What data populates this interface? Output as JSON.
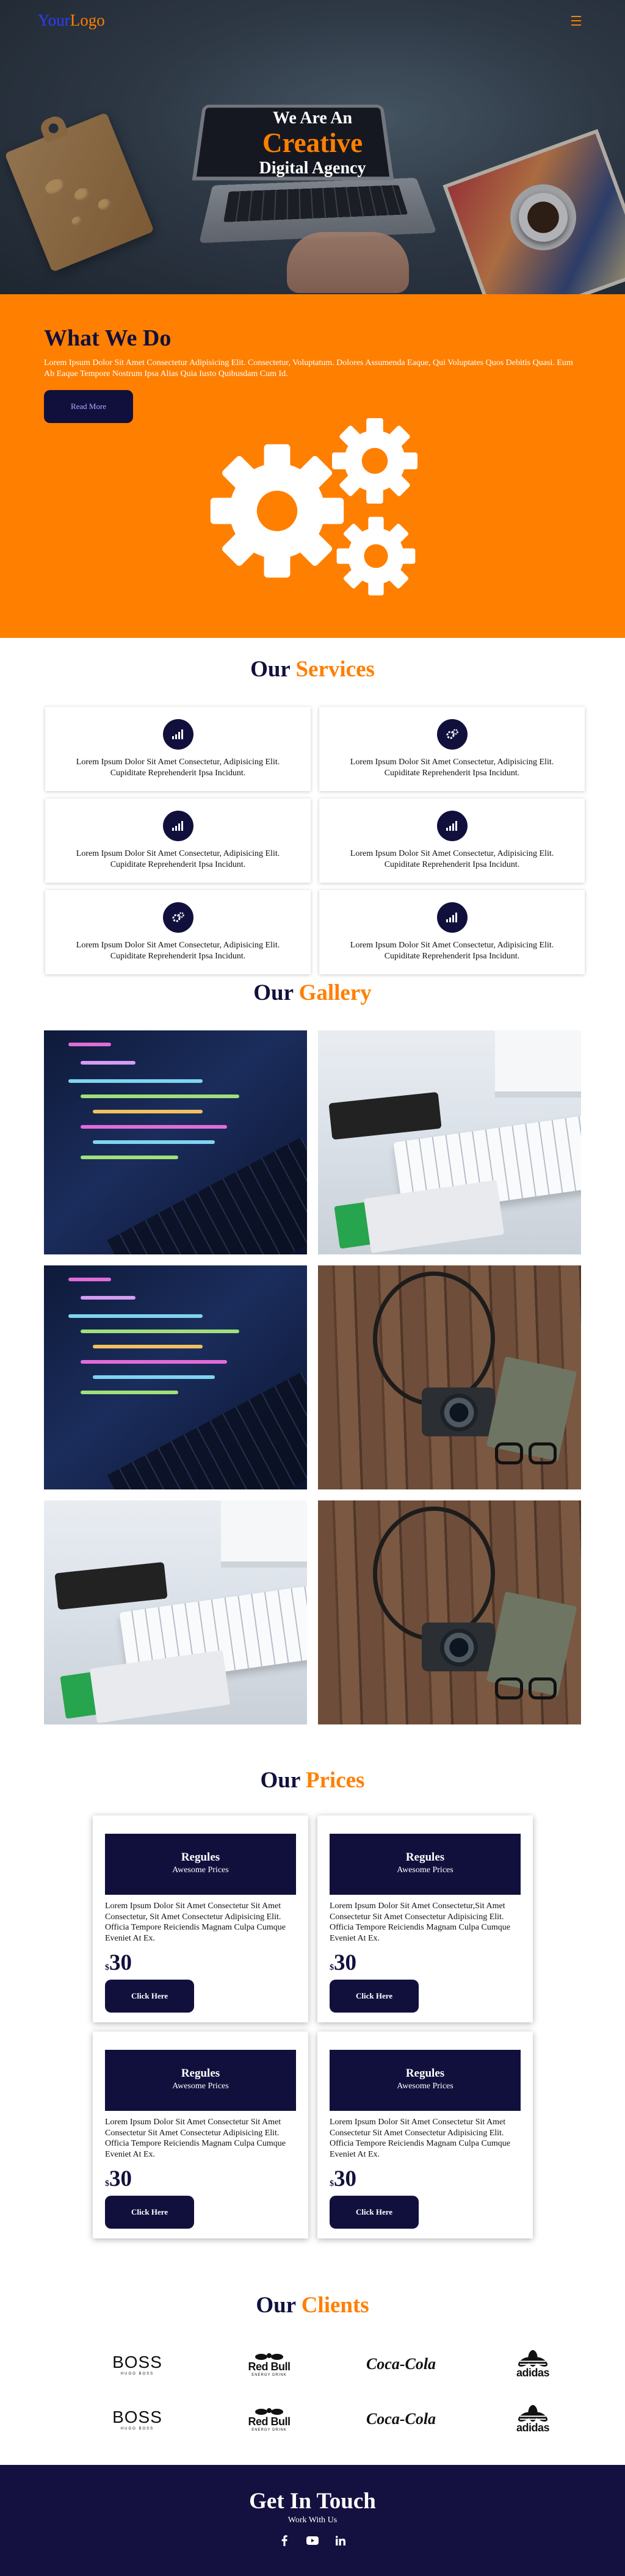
{
  "colors": {
    "accent": "#ff7f00",
    "navy": "#11103d",
    "logo_blue": "#2f3cff"
  },
  "nav": {
    "logo_part1": "Your",
    "logo_part2": "Logo",
    "menu_icon": "hamburger-icon"
  },
  "hero": {
    "line1": "We Are An",
    "line2": "Creative",
    "line3": "Digital Agency"
  },
  "what_we_do": {
    "title": "What We Do",
    "text": "Lorem Ipsum Dolor Sit Amet Consectetur Adipisicing Elit. Consectetur, Voluptatum. Dolores Assumenda Eaque, Qui Voluptates Quos Debitis Quasi. Eum Ab Eaque Tempore Nostrum Ipsa Alias Quia Iusto Quibusdam Cum Id.",
    "button": "Read More",
    "illustration": "gears-icon"
  },
  "services": {
    "title_a": "Our",
    "title_b": "Services",
    "items": [
      {
        "icon": "signal-icon",
        "text": "Lorem Ipsum Dolor Sit Amet Consectetur, Adipisicing Elit. Cupiditate Reprehenderit Ipsa Incidunt."
      },
      {
        "icon": "gears-icon",
        "text": "Lorem Ipsum Dolor Sit Amet Consectetur, Adipisicing Elit. Cupiditate Reprehenderit Ipsa Incidunt."
      },
      {
        "icon": "signal-icon",
        "text": "Lorem Ipsum Dolor Sit Amet Consectetur, Adipisicing Elit. Cupiditate Reprehenderit Ipsa Incidunt."
      },
      {
        "icon": "signal-icon",
        "text": "Lorem Ipsum Dolor Sit Amet Consectetur, Adipisicing Elit. Cupiditate Reprehenderit Ipsa Incidunt."
      },
      {
        "icon": "gears-icon",
        "text": "Lorem Ipsum Dolor Sit Amet Consectetur, Adipisicing Elit. Cupiditate Reprehenderit Ipsa Incidunt."
      },
      {
        "icon": "signal-icon",
        "text": "Lorem Ipsum Dolor Sit Amet Consectetur, Adipisicing Elit. Cupiditate Reprehenderit Ipsa Incidunt."
      }
    ]
  },
  "gallery": {
    "title_a": "Our",
    "title_b": "Gallery",
    "images": [
      "code-photo",
      "keyboard-photo",
      "code-photo",
      "camera-photo",
      "keyboard-photo",
      "camera-photo"
    ]
  },
  "prices": {
    "title_a": "Our",
    "title_b": "Prices",
    "plans": [
      {
        "name": "Regules",
        "subtitle": "Awesome Prices",
        "desc": "Lorem Ipsum Dolor Sit Amet Consectetur Sit Amet Consectetur, Sit Amet Consectetur Adipisicing Elit. Officia Tempore Reiciendis Magnam Culpa Cumque Eveniet At Ex.",
        "currency": "$",
        "amount": "30",
        "button": "Click Here"
      },
      {
        "name": "Regules",
        "subtitle": "Awesome Prices",
        "desc": "Lorem Ipsum Dolor Sit Amet Consectetur,Sit Amet Consectetur Sit Amet Consectetur Adipisicing Elit. Officia Tempore Reiciendis Magnam Culpa Cumque Eveniet At Ex.",
        "currency": "$",
        "amount": "30",
        "button": "Click Here"
      },
      {
        "name": "Regules",
        "subtitle": "Awesome Prices",
        "desc": "Lorem Ipsum Dolor Sit Amet Consectetur Sit Amet Consectetur Sit Amet Consectetur Adipisicing Elit. Officia Tempore Reiciendis Magnam Culpa Cumque Eveniet At Ex.",
        "currency": "$",
        "amount": "30",
        "button": "Click Here"
      },
      {
        "name": "Regules",
        "subtitle": "Awesome Prices",
        "desc": "Lorem Ipsum Dolor Sit Amet Consectetur Sit Amet Consectetur Sit Amet Consectetur Adipisicing Elit. Officia Tempore Reiciendis Magnam Culpa Cumque Eveniet At Ex.",
        "currency": "$",
        "amount": "30",
        "button": "Click Here"
      }
    ]
  },
  "clients": {
    "title_a": "Our",
    "title_b": "Clients",
    "logos": [
      {
        "type": "boss",
        "main": "BOSS",
        "sub": "HUGO BOSS"
      },
      {
        "type": "redbull",
        "main": "Red Bull",
        "sub": "ENERGY DRINK"
      },
      {
        "type": "coke",
        "main": "Coca-Cola",
        "sub": ""
      },
      {
        "type": "adidas",
        "main": "adidas",
        "sub": ""
      },
      {
        "type": "boss",
        "main": "BOSS",
        "sub": "HUGO BOSS"
      },
      {
        "type": "redbull",
        "main": "Red Bull",
        "sub": "ENERGY DRINK"
      },
      {
        "type": "coke",
        "main": "Coca-Cola",
        "sub": ""
      },
      {
        "type": "adidas",
        "main": "adidas",
        "sub": ""
      }
    ]
  },
  "footer": {
    "title": "Get In Touch",
    "subtitle": "Work With Us",
    "social": [
      "facebook-icon",
      "youtube-icon",
      "linkedin-icon"
    ]
  }
}
